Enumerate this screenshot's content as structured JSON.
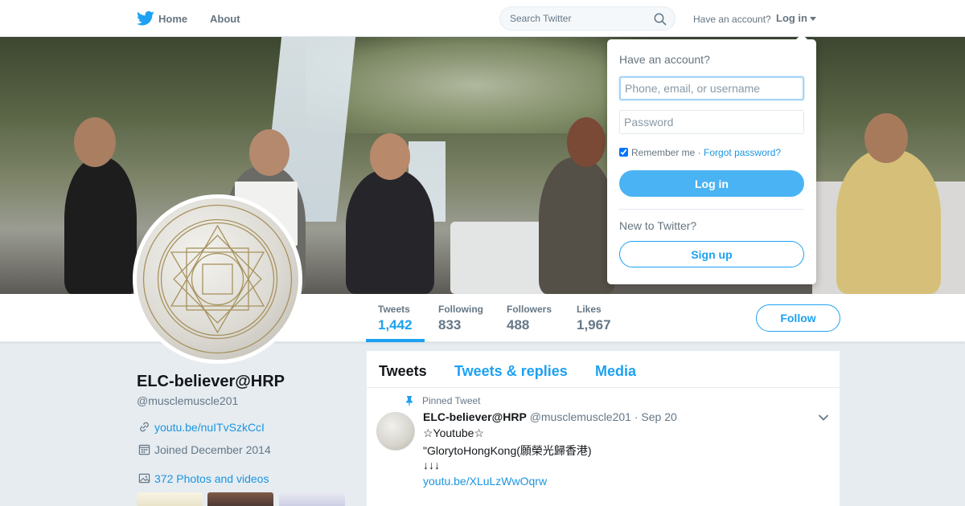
{
  "topbar": {
    "home_label": "Home",
    "about_label": "About",
    "search_placeholder": "Search Twitter",
    "have_account_text": "Have an account?",
    "login_label": "Log in"
  },
  "login_dropdown": {
    "heading": "Have an account?",
    "username_placeholder": "Phone, email, or username",
    "password_placeholder": "Password",
    "remember_label": "Remember me",
    "separator": "·",
    "forgot_label": "Forgot password?",
    "login_button": "Log in",
    "new_prompt": "New to Twitter?",
    "signup_button": "Sign up",
    "remember_checked": true
  },
  "stats": [
    {
      "label": "Tweets",
      "value": "1,442",
      "active": true
    },
    {
      "label": "Following",
      "value": "833",
      "active": false
    },
    {
      "label": "Followers",
      "value": "488",
      "active": false
    },
    {
      "label": "Likes",
      "value": "1,967",
      "active": false
    }
  ],
  "follow_button": "Follow",
  "profile": {
    "name": "ELC-believer@HRP",
    "handle": "@musclemuscle201",
    "link": "youtu.be/nuITvSzkCcI",
    "joined": "Joined December 2014",
    "photos": "372 Photos and videos"
  },
  "timeline": {
    "tabs": [
      "Tweets",
      "Tweets & replies",
      "Media"
    ],
    "active_tab": "Tweets",
    "pinned_label": "Pinned Tweet",
    "tweet": {
      "name": "ELC-believer@HRP",
      "handle": "@musclemuscle201",
      "dot": "·",
      "date": "Sep 20",
      "lines": [
        "☆Youtube☆",
        "\"GlorytoHongKong(願榮光歸香港)",
        "↓↓↓",
        "youtu.be/XLuLzWwOqrw"
      ]
    }
  },
  "colors": {
    "accent": "#1da1f2",
    "link": "#1b95e0",
    "muted": "#657786",
    "background": "#e6ecf0"
  },
  "icons": [
    "twitter-bird-icon",
    "search-icon",
    "caret-down-icon",
    "link-icon",
    "calendar-icon",
    "photos-icon",
    "pin-icon",
    "chevron-down-icon"
  ]
}
